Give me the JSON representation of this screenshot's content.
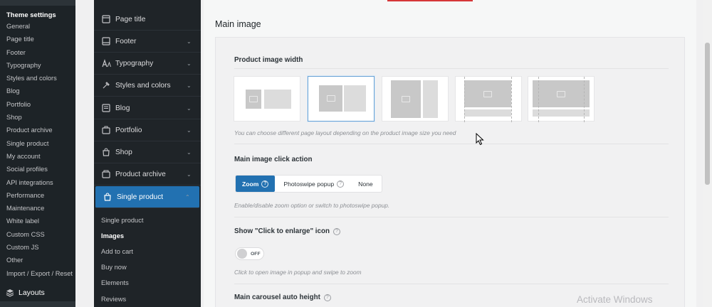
{
  "wp_sidebar": {
    "header": "Theme settings",
    "items": [
      "General",
      "Page title",
      "Footer",
      "Typography",
      "Styles and colors",
      "Blog",
      "Portfolio",
      "Shop",
      "Product archive",
      "Single product",
      "My account",
      "Social profiles",
      "API integrations",
      "Performance",
      "Maintenance",
      "White label",
      "Custom CSS",
      "Custom JS",
      "Other",
      "Import / Export / Reset"
    ],
    "layouts_label": "Layouts"
  },
  "nav": {
    "items": [
      {
        "label": "Page title",
        "icon": "page-title-icon",
        "chevron": false
      },
      {
        "label": "Footer",
        "icon": "footer-icon",
        "chevron": true
      },
      {
        "label": "Typography",
        "icon": "typography-icon",
        "chevron": true
      },
      {
        "label": "Styles and colors",
        "icon": "palette-icon",
        "chevron": true
      },
      {
        "label": "Blog",
        "icon": "blog-icon",
        "chevron": true
      },
      {
        "label": "Portfolio",
        "icon": "portfolio-icon",
        "chevron": true
      },
      {
        "label": "Shop",
        "icon": "shop-icon",
        "chevron": true
      },
      {
        "label": "Product archive",
        "icon": "product-archive-icon",
        "chevron": true
      },
      {
        "label": "Single product",
        "icon": "single-product-icon",
        "chevron": true,
        "active": true
      }
    ],
    "sub_items": [
      "Single product",
      "Images",
      "Add to cart",
      "Buy now",
      "Elements",
      "Reviews"
    ],
    "active_sub": "Images",
    "accent": "#2271b1"
  },
  "main": {
    "section_title": "Main image",
    "product_image_width": {
      "label": "Product image width",
      "help": "You can choose different page layout depending on the product image size you need",
      "selected_index": 1
    },
    "click_action": {
      "label": "Main image click action",
      "options": [
        "Zoom",
        "Photoswipe popup",
        "None"
      ],
      "selected": "Zoom",
      "help": "Enable/disable zoom option or switch to photoswipe popup."
    },
    "click_to_enlarge": {
      "label": "Show \"Click to enlarge\" icon",
      "toggle_text": "OFF",
      "help": "Click to open image in popup and swipe to zoom"
    },
    "carousel": {
      "label": "Main carousel auto height"
    }
  },
  "watermark": "Activate Windows"
}
